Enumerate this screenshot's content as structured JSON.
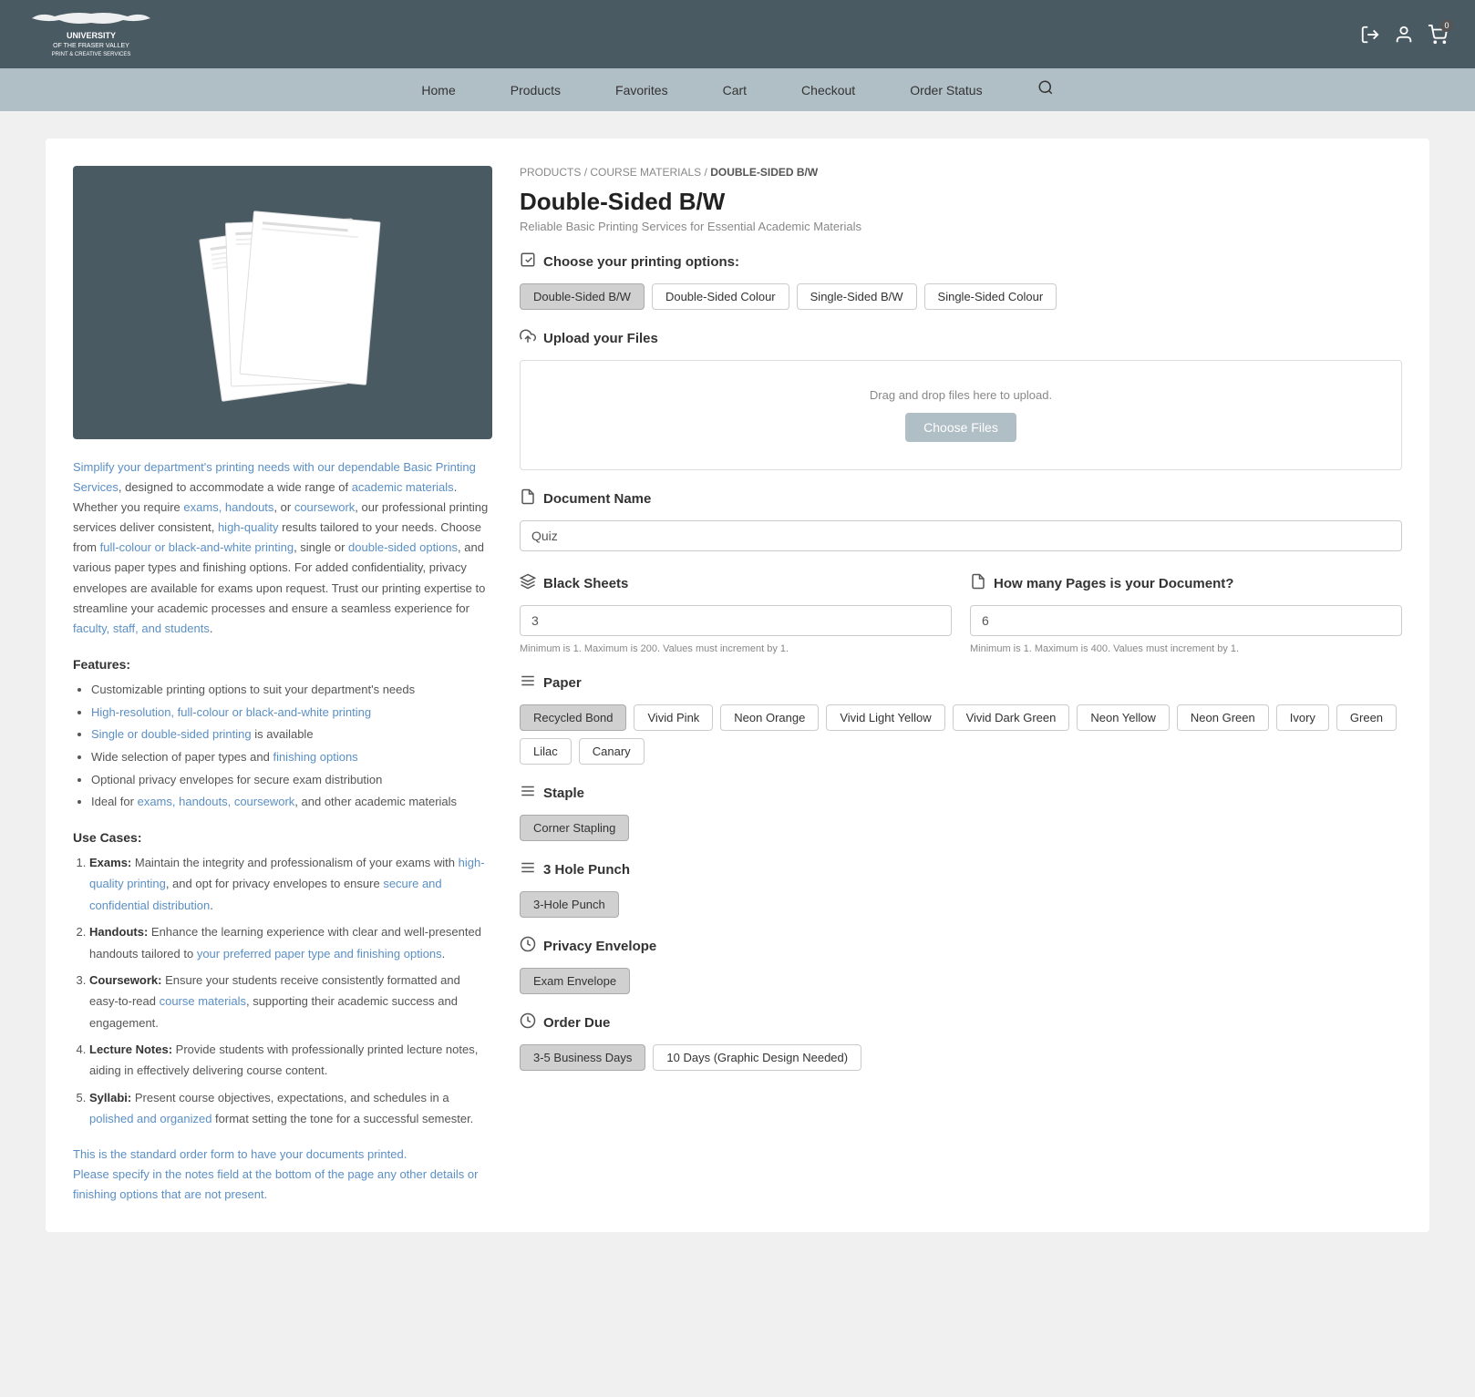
{
  "header": {
    "logo_line1": "UNIVERSITY",
    "logo_line2": "OF THE",
    "logo_line3": "FRASER VALLEY",
    "logo_sub": "PRINT & CREATIVE SERVICES",
    "cart_count": "0",
    "icons": {
      "logout": "⎋",
      "user": "👤",
      "cart": "🛒"
    }
  },
  "nav": {
    "items": [
      {
        "label": "Home",
        "id": "home"
      },
      {
        "label": "Products",
        "id": "products"
      },
      {
        "label": "Favorites",
        "id": "favorites"
      },
      {
        "label": "Cart",
        "id": "cart"
      },
      {
        "label": "Checkout",
        "id": "checkout"
      },
      {
        "label": "Order Status",
        "id": "order-status"
      }
    ]
  },
  "breadcrumb": {
    "items": [
      "PRODUCTS",
      "COURSE MATERIALS",
      "DOUBLE-SIDED B/W"
    ]
  },
  "product": {
    "title": "Double-Sided B/W",
    "subtitle": "Reliable Basic Printing Services for Essential Academic Materials"
  },
  "sections": {
    "printing_options": {
      "label": "Choose your printing options:",
      "icon": "✅",
      "options": [
        {
          "label": "Double-Sided B/W",
          "selected": true
        },
        {
          "label": "Double-Sided Colour",
          "selected": false
        },
        {
          "label": "Single-Sided B/W",
          "selected": false
        },
        {
          "label": "Single-Sided Colour",
          "selected": false
        }
      ]
    },
    "upload": {
      "label": "Upload your Files",
      "icon": "⬆",
      "drag_text": "Drag and drop files here to upload.",
      "button_label": "Choose Files"
    },
    "document_name": {
      "label": "Document Name",
      "icon": "📝",
      "value": "Quiz",
      "placeholder": "Quiz"
    },
    "black_sheets": {
      "label": "Black Sheets",
      "icon": "📄",
      "value": "3",
      "hint": "Minimum is 1. Maximum is 200. Values must increment by 1."
    },
    "pages": {
      "label": "How many Pages is your Document?",
      "icon": "📄",
      "value": "6",
      "hint": "Minimum is 1. Maximum is 400. Values must increment by 1."
    },
    "paper": {
      "label": "Paper",
      "icon": "≡",
      "options": [
        {
          "label": "Recycled Bond",
          "selected": true
        },
        {
          "label": "Vivid Pink",
          "selected": false
        },
        {
          "label": "Neon Orange",
          "selected": false
        },
        {
          "label": "Vivid Light Yellow",
          "selected": false
        },
        {
          "label": "Vivid Dark Green",
          "selected": false
        },
        {
          "label": "Neon Yellow",
          "selected": false
        },
        {
          "label": "Neon Green",
          "selected": false
        },
        {
          "label": "Ivory",
          "selected": false
        },
        {
          "label": "Green",
          "selected": false
        },
        {
          "label": "Lilac",
          "selected": false
        },
        {
          "label": "Canary",
          "selected": false
        }
      ]
    },
    "staple": {
      "label": "Staple",
      "icon": "≡",
      "options": [
        {
          "label": "Corner Stapling",
          "selected": true
        }
      ]
    },
    "hole_punch": {
      "label": "3 Hole Punch",
      "icon": "≡",
      "options": [
        {
          "label": "3-Hole Punch",
          "selected": true
        }
      ]
    },
    "privacy_envelope": {
      "label": "Privacy Envelope",
      "icon": "⏱",
      "options": [
        {
          "label": "Exam Envelope",
          "selected": true
        }
      ]
    },
    "order_due": {
      "label": "Order Due",
      "icon": "⏱",
      "options": [
        {
          "label": "3-5 Business Days",
          "selected": true
        },
        {
          "label": "10 Days (Graphic Design Needed)",
          "selected": false
        }
      ]
    }
  },
  "description": {
    "main": "Simplify your department's printing needs with our dependable Basic Printing Services, designed to accommodate a wide range of academic materials. Whether you require exams, handouts, or coursework, our professional printing services deliver consistent, high-quality results tailored to your needs. Choose from full-colour or black-and-white printing, single or double-sided options, and various paper types and finishing options. For added confidentiality, privacy envelopes are available for exams upon request. Trust our printing expertise to streamline your academic processes and ensure a seamless experience for faculty, staff, and students.",
    "features_title": "Features:",
    "features": [
      "Customizable printing options to suit your department's needs",
      "High-resolution, full-colour or black-and-white printing",
      "Single or double-sided printing is available",
      "Wide selection of paper types and finishing options",
      "Optional privacy envelopes for secure exam distribution",
      "Ideal for exams, handouts, coursework, and other academic materials"
    ],
    "use_cases_title": "Use Cases:",
    "use_cases": [
      {
        "bold": "Exams:",
        "text": " Maintain the integrity and professionalism of your exams with high-quality printing, and opt for privacy envelopes to ensure secure and confidential distribution."
      },
      {
        "bold": "Handouts:",
        "text": " Enhance the learning experience with clear and well-presented handouts tailored to your preferred paper type and finishing options."
      },
      {
        "bold": "Coursework:",
        "text": " Ensure your students receive consistently formatted and easy-to-read course materials, supporting their academic success and engagement."
      },
      {
        "bold": "Lecture Notes:",
        "text": " Provide students with professionally printed lecture notes, aiding in effectively delivering course content."
      },
      {
        "bold": "Syllabi:",
        "text": " Present course objectives, expectations, and schedules in a polished and organized format setting the tone for a successful semester."
      }
    ],
    "note1": "This is the standard order form to have your documents printed.",
    "note2": "Please specify in the notes field at the bottom of the page any other details or finishing options that are not present."
  }
}
